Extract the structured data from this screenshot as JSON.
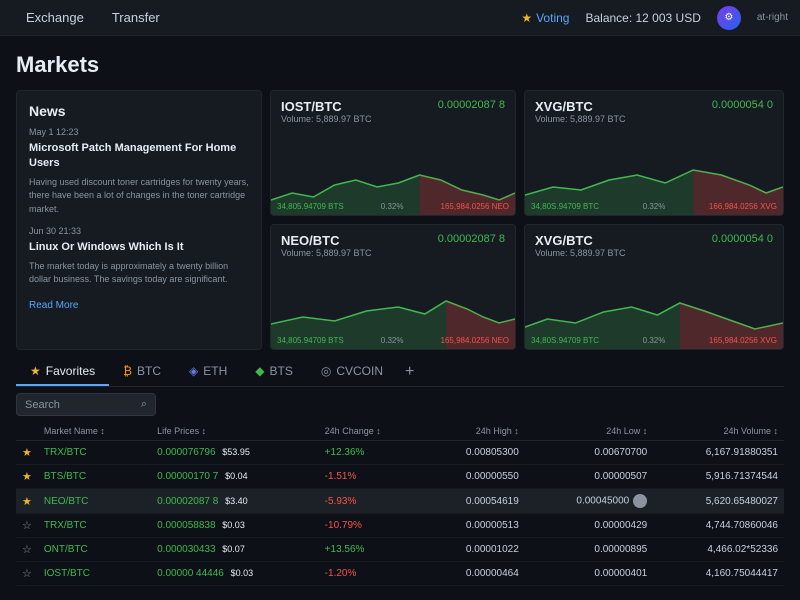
{
  "topnav": {
    "brand": "",
    "exchange_label": "Exchange",
    "transfer_label": "Transfer",
    "voting_label": "Voting",
    "balance_label": "Balance: 12 003 USD",
    "user_label": "at-right"
  },
  "page": {
    "title": "Markets"
  },
  "market_cards": [
    {
      "pair": "IOST/BTC",
      "price": "0.00002087 8",
      "volume": "Volume: 5,889.97 BTC",
      "label_left": "34,805.94709 BTS",
      "label_right": "165,984.0256 NEO",
      "pct": "0.32%"
    },
    {
      "pair": "XVG/BTC",
      "price": "0.0000054 0",
      "volume": "Volume: 5,889.97 BTC",
      "label_left": "34,80S.94709 BTC",
      "label_right": "166,984.0256 XVG",
      "pct": "0.32%"
    },
    {
      "pair": "NEO/BTC",
      "price": "0.00002087 8",
      "volume": "Volume: 5,889.97 BTC",
      "label_left": "34,805.94709 BTS",
      "label_right": "165,984.0256 NEO",
      "pct": "0.32%"
    },
    {
      "pair": "XVG/BTC",
      "price": "0.0000054 0",
      "volume": "Volume: 5,889.97 BTC",
      "label_left": "34,80S.94709 BTC",
      "label_right": "165,984.0256 XVG",
      "pct": "0.32%"
    }
  ],
  "news": {
    "section_title": "News",
    "articles": [
      {
        "date": "May 1 12:23",
        "title": "Microsoft Patch Management For Home Users",
        "body": "Having used discount toner cartridges for twenty years, there have been a lot of changes in the toner cartridge market."
      },
      {
        "date": "Jun 30 21:33",
        "title": "Linux Or Windows Which Is It",
        "body": "The market today is approximately a twenty billion dollar business. The savings today are significant."
      }
    ],
    "read_more": "Read More"
  },
  "favorites_tabs": [
    {
      "label": "Favorites",
      "icon": "★",
      "active": true
    },
    {
      "label": "BTC",
      "icon": "₿"
    },
    {
      "label": "ETH",
      "icon": "◈"
    },
    {
      "label": "BTS",
      "icon": "◆"
    },
    {
      "label": "CVCOIN",
      "icon": "◎"
    }
  ],
  "table": {
    "search_placeholder": "Search",
    "headers": [
      "",
      "Market Name ↕",
      "Life Prices ↕",
      "24h Change ↕",
      "24h High ↕",
      "24h Low ↕",
      "24h Volume ↕"
    ],
    "rows": [
      {
        "star": true,
        "pair": "TRX/BTC",
        "price_crypto": "0.000076796",
        "price_usd": "$53.95",
        "change": "+12.36%",
        "change_pos": true,
        "high": "0.00805300",
        "low": "0.00670700",
        "volume": "6,167.91880351",
        "active": false
      },
      {
        "star": true,
        "pair": "BTS/BTC",
        "price_crypto": "0.00000170 7",
        "price_usd": "$0.04",
        "change": "-1.51%",
        "change_pos": false,
        "high": "0.00000550",
        "low": "0.00000507",
        "volume": "5,916.71374544",
        "active": false
      },
      {
        "star": true,
        "pair": "NEO/BTC",
        "price_crypto": "0.00002087 8",
        "price_usd": "$3.40",
        "change": "-5.93%",
        "change_pos": false,
        "high": "0.00054619",
        "low": "0.00045000",
        "volume": "5,620.65480027",
        "active": true
      },
      {
        "star": false,
        "pair": "TRX/BTC",
        "price_crypto": "0.000058838",
        "price_usd": "$0.03",
        "change": "-10.79%",
        "change_pos": false,
        "high": "0.00000513",
        "low": "0.00000429",
        "volume": "4,744.70860046",
        "active": false
      },
      {
        "star": false,
        "pair": "ONT/BTC",
        "price_crypto": "0.000030433",
        "price_usd": "$0.07",
        "change": "+13.56%",
        "change_pos": true,
        "high": "0.00001022",
        "low": "0.00000895",
        "volume": "4,466.02*52336",
        "active": false
      },
      {
        "star": false,
        "pair": "IOST/BTC",
        "price_crypto": "0.00000 44446",
        "price_usd": "$0.03",
        "change": "-1.20%",
        "change_pos": false,
        "high": "0.00000464",
        "low": "0.00000401",
        "volume": "4,160.75044417",
        "active": false
      }
    ]
  }
}
